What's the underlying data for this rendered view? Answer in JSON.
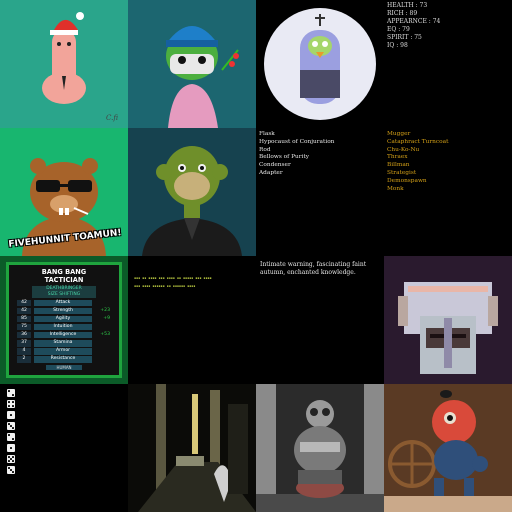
{
  "stats": [
    "HEALTH : 73",
    "RICH : 89",
    "APPEARNCE : 74",
    "EQ : 79",
    "SPIRIT : 75",
    "IQ : 98"
  ],
  "items": [
    "Flask",
    "Hypocaust of Conjuration",
    "Rod",
    "Bellows of Purity",
    "Condenser",
    "Adapter"
  ],
  "classes": [
    "Mugger",
    "Cataphract Turncoat",
    "Chu-Ko-Nu",
    "Thraex",
    "Billman",
    "Strategist",
    "Demonspawn",
    "Monk"
  ],
  "flavor_text": "Intimate warning, fascinating faint autumn, enchanted knowledge.",
  "caption": "FIVEHUNNIT TOAMUN!",
  "card": {
    "title_line1": "BANG BANG",
    "title_line2": "TACTICIAN",
    "subtitle_line1": "DEATHBRINGER",
    "subtitle_line2": "SIZE SHIFTING",
    "rows": [
      {
        "num": "42",
        "label": "Attack",
        "bonus": ""
      },
      {
        "num": "42",
        "label": "Strength",
        "bonus": "+23"
      },
      {
        "num": "85",
        "label": "Agility",
        "bonus": "+9"
      },
      {
        "num": "75",
        "label": "Intuition",
        "bonus": ""
      },
      {
        "num": "36",
        "label": "Intelligence",
        "bonus": "+53"
      },
      {
        "num": "37",
        "label": "Stamina",
        "bonus": ""
      },
      {
        "num": "4",
        "label": "Armor",
        "bonus": ""
      },
      {
        "num": "2",
        "label": "Resistance",
        "bonus": ""
      }
    ],
    "footer": "HUMAN"
  },
  "colors": {
    "accent_gold": "#d4a017",
    "card_border": "#1fa43e",
    "bonus_green": "#2fd14c"
  }
}
